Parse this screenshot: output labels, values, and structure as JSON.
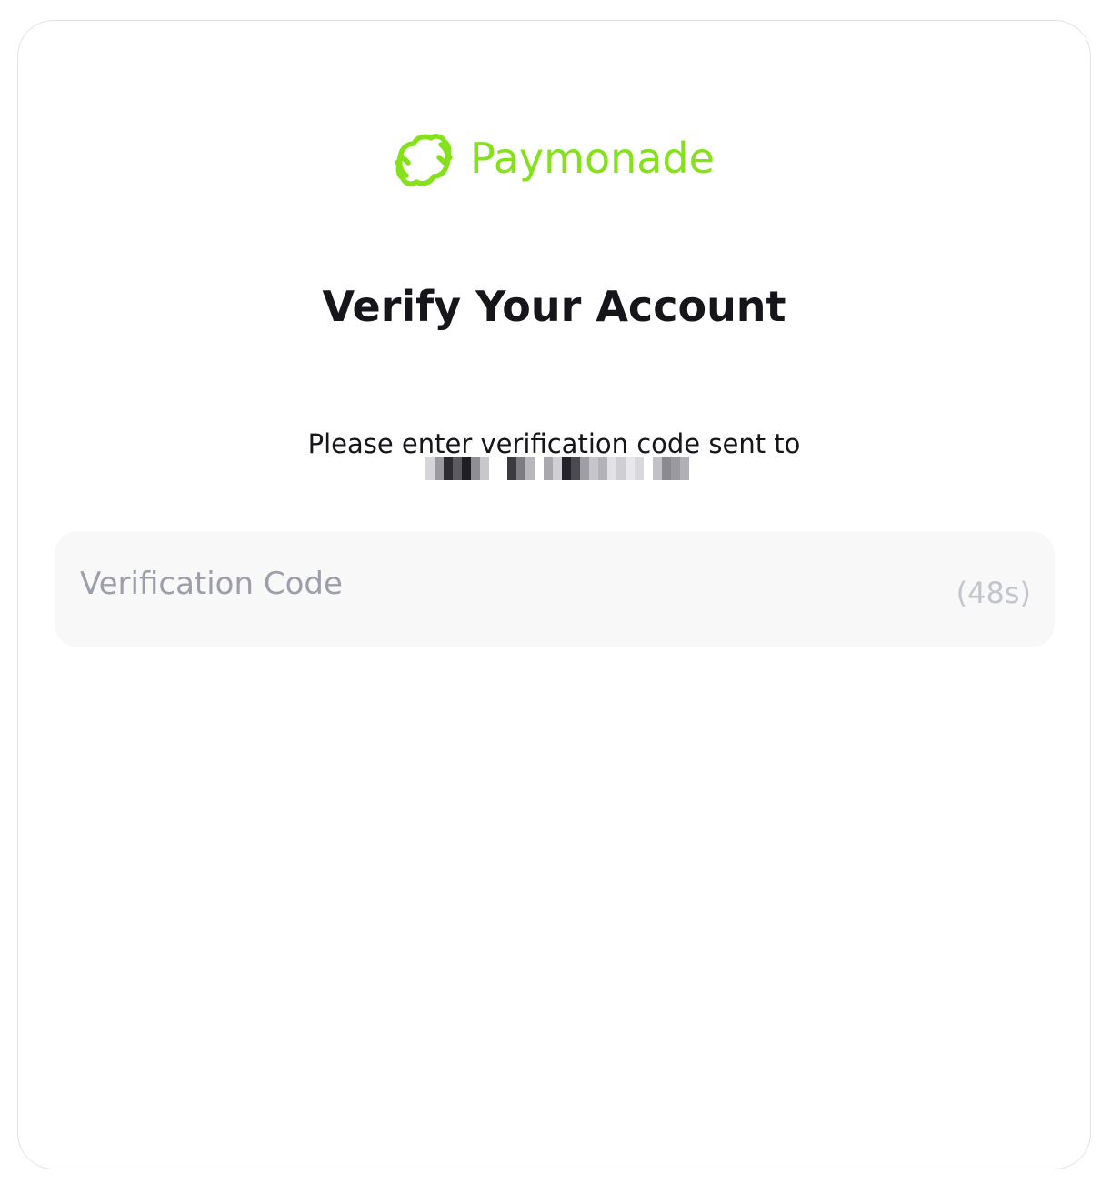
{
  "brand": {
    "name": "Paymonade",
    "logo_icon": "paymonade-logo-icon",
    "accent_color": "#84e11a"
  },
  "page": {
    "title": "Verify Your Account",
    "instruction": "Please enter verification code sent to"
  },
  "recipient": {
    "redacted": true,
    "icon": "redacted-contact-blur"
  },
  "verification": {
    "placeholder": "Verification Code",
    "value": "",
    "resend_countdown": "(48s)"
  }
}
